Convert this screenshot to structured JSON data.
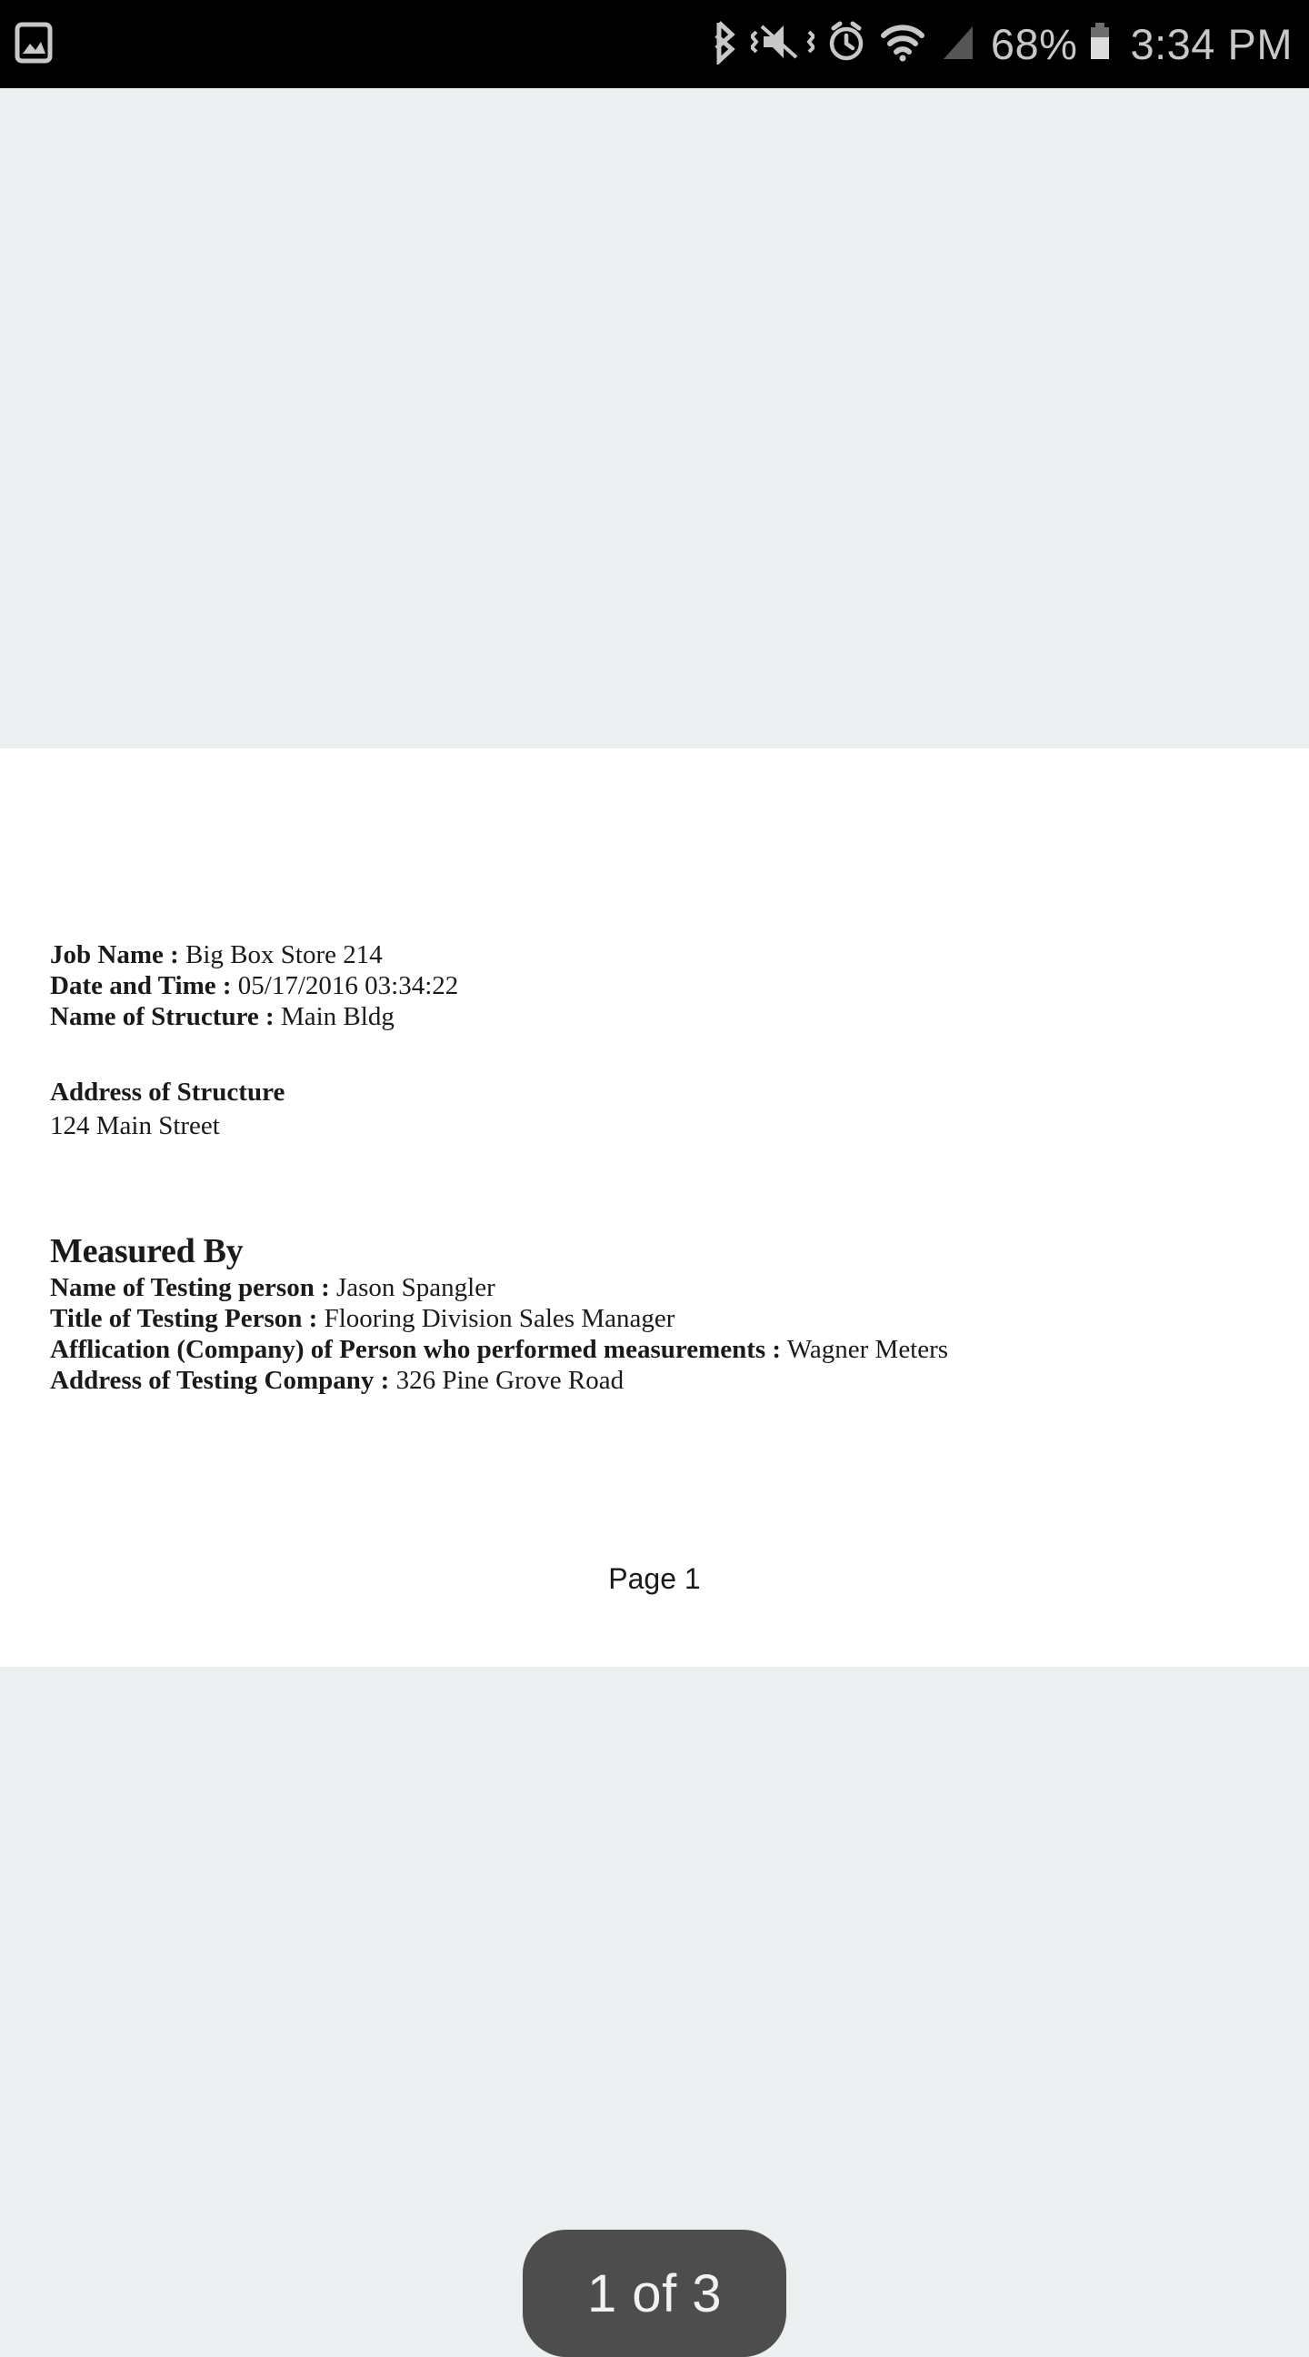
{
  "status_bar": {
    "notification_icon": "image-notification-icon",
    "icons": [
      "bluetooth-icon",
      "vibrate-mute-icon",
      "alarm-clock-icon",
      "wifi-icon",
      "cellular-signal-icon"
    ],
    "battery_percent": "68%",
    "battery_icon": "battery-icon",
    "clock": "3:34 PM",
    "background_color": "#000000",
    "text_color": "#c8c8c8"
  },
  "viewer": {
    "background_color": "#ecf0f1",
    "page_background_color": "#ffffff"
  },
  "document": {
    "job_block": [
      {
        "label": "Job Name :",
        "value": "Big Box Store 214"
      },
      {
        "label": "Date and Time :",
        "value": "05/17/2016 03:34:22"
      },
      {
        "label": "Name of Structure :",
        "value": "Main Bldg"
      }
    ],
    "address_block": {
      "heading": "Address of Structure",
      "line": "124 Main Street"
    },
    "measured_by": {
      "heading": "Measured By",
      "fields": [
        {
          "label": "Name of Testing person :",
          "value": "Jason Spangler"
        },
        {
          "label": "Title of Testing Person :",
          "value": "Flooring Division Sales Manager"
        },
        {
          "label": "Afflication (Company) of Person who performed measurements :",
          "value": "Wagner Meters"
        },
        {
          "label": "Address of Testing Company :",
          "value": "326 Pine Grove Road"
        }
      ]
    },
    "footer": "Page 1"
  },
  "page_indicator": {
    "label": "1 of 3",
    "background_color": "#4d4d4d",
    "text_color": "#f2f2f2"
  }
}
